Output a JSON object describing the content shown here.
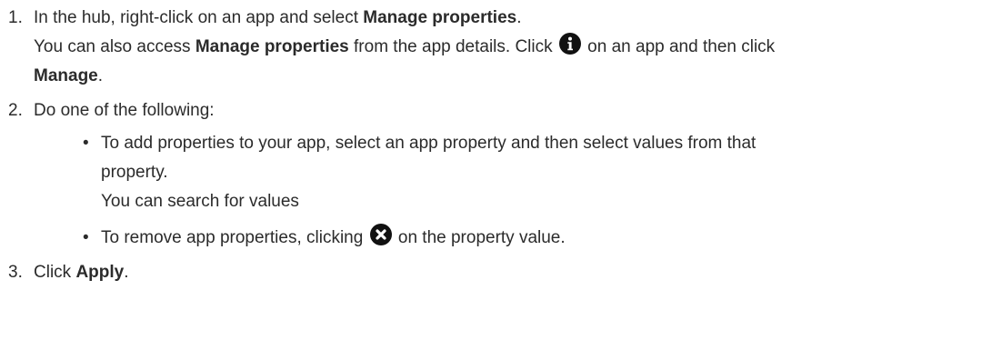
{
  "steps": [
    {
      "number": "1.",
      "line1": {
        "t1": "In the hub, right-click on an app and select ",
        "b1": "Manage properties",
        "t2": "."
      },
      "line2": {
        "t1": "You can also access ",
        "b1": "Manage properties",
        "t2": " from the app details. Click ",
        "icon": "info-icon",
        "t3": " on an app and then click"
      },
      "line3": {
        "b1": "Manage",
        "t1": "."
      }
    },
    {
      "number": "2.",
      "text": "Do one of the following:",
      "options": [
        {
          "bullet": "•",
          "line1": "To add properties to your app, select an app property and then select values from that",
          "line2": "property.",
          "line3": "You can search for values"
        },
        {
          "bullet": "•",
          "t1": "To remove app properties, clicking ",
          "icon": "remove-icon",
          "t2": " on the property value."
        }
      ]
    },
    {
      "number": "3.",
      "t1": "Click ",
      "b1": "Apply",
      "t2": "."
    }
  ]
}
